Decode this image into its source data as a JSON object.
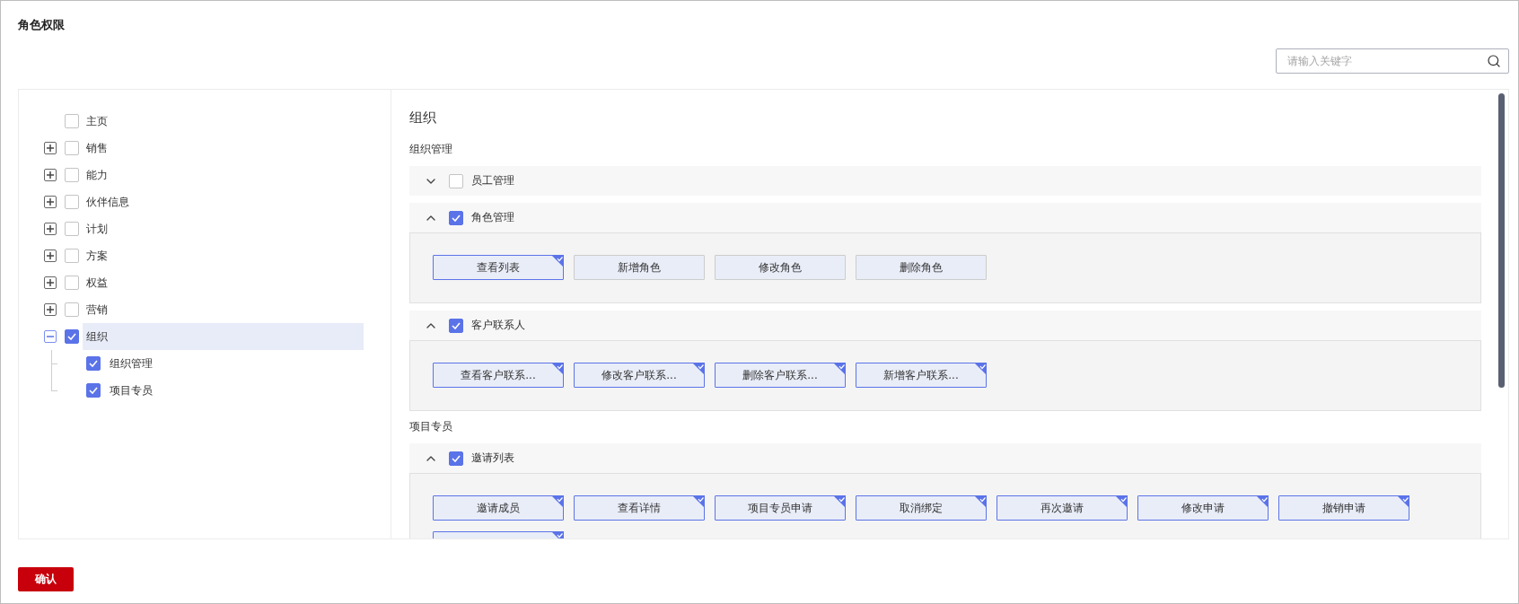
{
  "title": "角色权限",
  "search": {
    "placeholder": "请输入关键字"
  },
  "tree": {
    "items": [
      {
        "label": "主页",
        "kind": "leaf",
        "checked": false,
        "selected": false
      },
      {
        "label": "销售",
        "kind": "branch",
        "expanded": false,
        "checked": false,
        "selected": false
      },
      {
        "label": "能力",
        "kind": "branch",
        "expanded": false,
        "checked": false,
        "selected": false
      },
      {
        "label": "伙伴信息",
        "kind": "branch",
        "expanded": false,
        "checked": false,
        "selected": false
      },
      {
        "label": "计划",
        "kind": "branch",
        "expanded": false,
        "checked": false,
        "selected": false
      },
      {
        "label": "方案",
        "kind": "branch",
        "expanded": false,
        "checked": false,
        "selected": false
      },
      {
        "label": "权益",
        "kind": "branch",
        "expanded": false,
        "checked": false,
        "selected": false
      },
      {
        "label": "营销",
        "kind": "branch",
        "expanded": false,
        "checked": false,
        "selected": false
      },
      {
        "label": "组织",
        "kind": "branch",
        "expanded": true,
        "checked": true,
        "selected": true,
        "children": [
          {
            "label": "组织管理",
            "checked": true,
            "selected": false
          },
          {
            "label": "项目专员",
            "checked": true,
            "selected": false
          }
        ]
      }
    ]
  },
  "detail": {
    "heading": "组织",
    "sections": [
      {
        "title": "组织管理",
        "groups": [
          {
            "label": "员工管理",
            "expanded": false,
            "checked": false
          },
          {
            "label": "角色管理",
            "expanded": true,
            "checked": true,
            "permissions": [
              {
                "label": "查看列表",
                "selected": true
              },
              {
                "label": "新增角色",
                "selected": false
              },
              {
                "label": "修改角色",
                "selected": false
              },
              {
                "label": "删除角色",
                "selected": false
              }
            ]
          },
          {
            "label": "客户联系人",
            "expanded": true,
            "checked": true,
            "permissions": [
              {
                "label": "查看客户联系...",
                "selected": true
              },
              {
                "label": "修改客户联系...",
                "selected": true
              },
              {
                "label": "删除客户联系...",
                "selected": true
              },
              {
                "label": "新增客户联系...",
                "selected": true
              }
            ]
          }
        ]
      },
      {
        "title": "项目专员",
        "groups": [
          {
            "label": "邀请列表",
            "expanded": true,
            "checked": true,
            "permissions": [
              {
                "label": "邀请成员",
                "selected": true
              },
              {
                "label": "查看详情",
                "selected": true
              },
              {
                "label": "项目专员申请",
                "selected": true
              },
              {
                "label": "取消绑定",
                "selected": true
              },
              {
                "label": "再次邀请",
                "selected": true
              },
              {
                "label": "修改申请",
                "selected": true
              },
              {
                "label": "撤销申请",
                "selected": true
              },
              {
                "selected": true
              }
            ]
          }
        ]
      }
    ]
  },
  "confirm_button": "确认"
}
